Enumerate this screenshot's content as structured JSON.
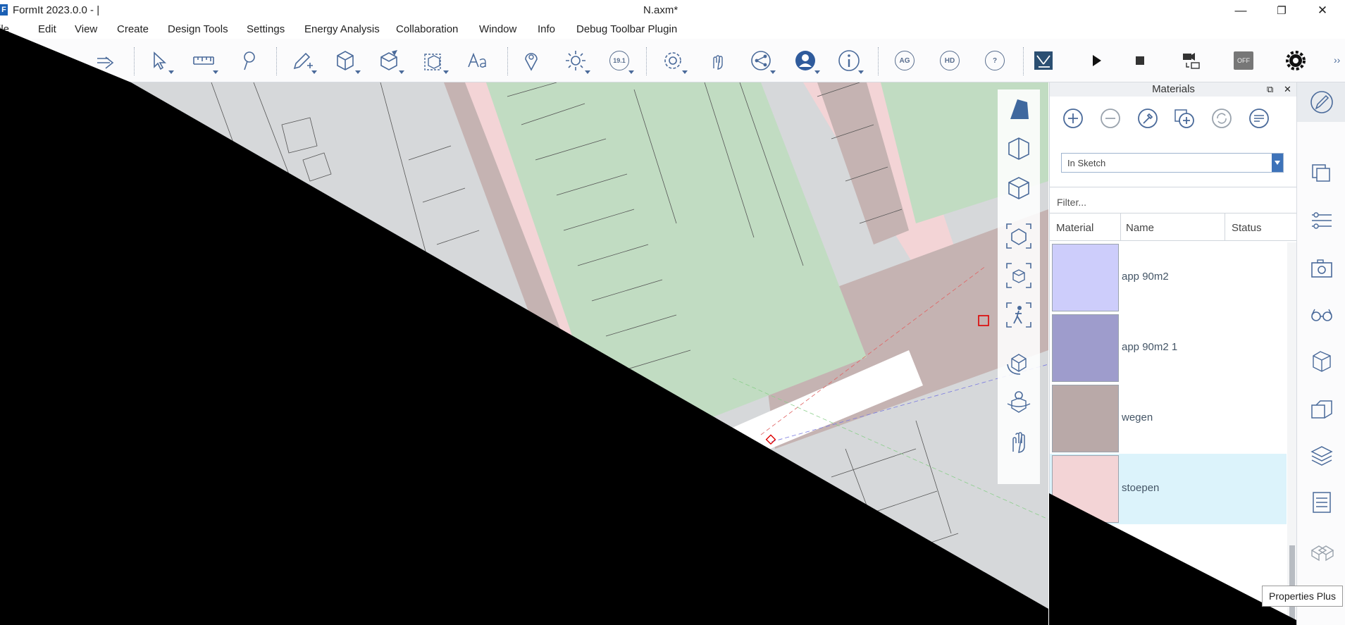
{
  "window": {
    "app_title": "FormIt 2023.0.0 - |",
    "document_title": "N.axm*",
    "minimize": "—",
    "restore": "❐",
    "close": "✕"
  },
  "menu": [
    "ile",
    "Edit",
    "View",
    "Create",
    "Design Tools",
    "Settings",
    "Energy Analysis",
    "Collaboration",
    "Window",
    "Info",
    "Debug Toolbar Plugin"
  ],
  "toolbar": {
    "level_badge": "19.1",
    "ag_badge": "AG",
    "hd_badge": "HD",
    "help_badge": "?",
    "off_badge": "OFF",
    "overflow": "››"
  },
  "materials_panel": {
    "title": "Materials",
    "popout": "⧉",
    "close": "✕",
    "dropdown_value": "In Sketch",
    "filter_placeholder": "Filter...",
    "columns": [
      "Material",
      "Name",
      "Status"
    ],
    "items": [
      {
        "name": "app 90m2",
        "color": "#cdcdfb"
      },
      {
        "name": "app 90m2 1",
        "color": "#9e9ccc"
      },
      {
        "name": "wegen",
        "color": "#b9a9a8"
      },
      {
        "name": "stoepen",
        "color": "#f3d4d6"
      }
    ],
    "selected_index": 3
  },
  "tooltip": "Properties Plus",
  "colors": {
    "accent": "#3e73b9",
    "icon": "#4a6a9a",
    "ground": "#d6d8da",
    "green_block": "#c1dcc2",
    "road": "#c5b3b2",
    "sidewalk": "#f3d4d6",
    "selected_row": "#dcf3fb"
  }
}
